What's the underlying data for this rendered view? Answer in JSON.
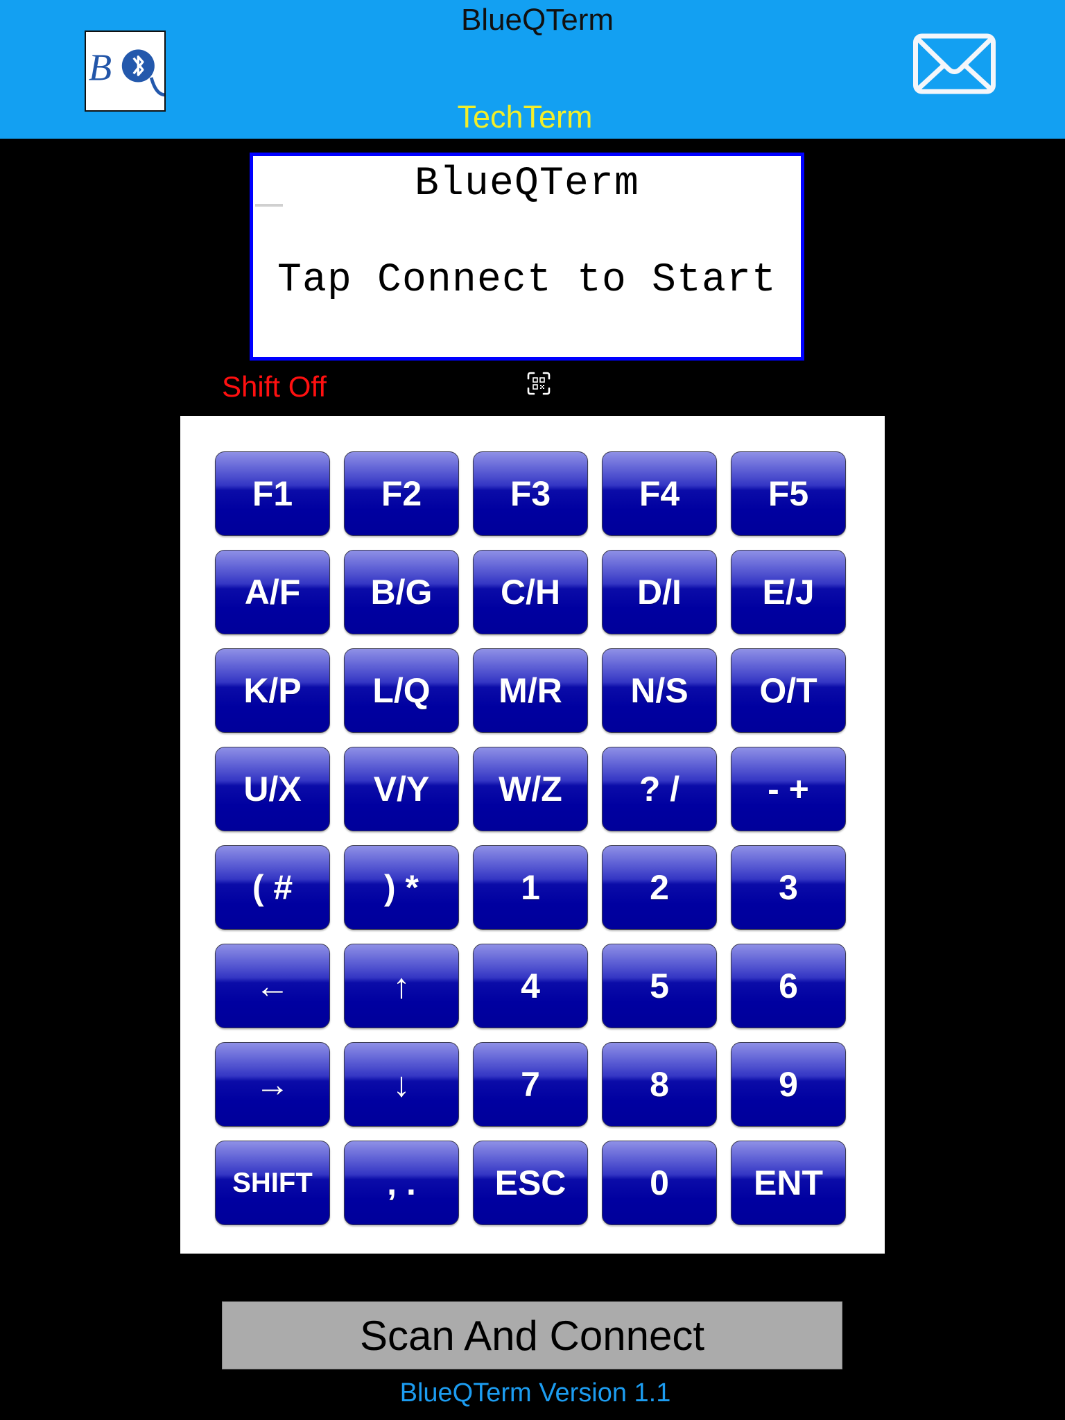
{
  "header": {
    "title": "BlueQTerm",
    "subtitle": "TechTerm",
    "logo_text": "BQ",
    "logo_icon": "bluetooth-icon",
    "mail_icon": "mail-icon"
  },
  "terminal": {
    "lines": [
      "BlueQTerm",
      "Tap Connect to Start"
    ]
  },
  "status": {
    "shift": "Shift Off",
    "qr_icon": "qr-scan-icon"
  },
  "keypad": {
    "rows": [
      [
        "F1",
        "F2",
        "F3",
        "F4",
        "F5"
      ],
      [
        "A/F",
        "B/G",
        "C/H",
        "D/I",
        "E/J"
      ],
      [
        "K/P",
        "L/Q",
        "M/R",
        "N/S",
        "O/T"
      ],
      [
        "U/X",
        "V/Y",
        "W/Z",
        "? /",
        "- +"
      ],
      [
        "( #",
        ") *",
        "1",
        "2",
        "3"
      ],
      [
        "←",
        "↑",
        "4",
        "5",
        "6"
      ],
      [
        "→",
        "↓",
        "7",
        "8",
        "9"
      ],
      [
        "SHIFT",
        ", .",
        "ESC",
        "0",
        "ENT"
      ]
    ]
  },
  "footer": {
    "scan_button": "Scan And Connect",
    "version": "BlueQTerm Version 1.1"
  },
  "colors": {
    "header_bg": "#13a0f2",
    "subtitle": "#f2ee2a",
    "terminal_border": "#0000ff",
    "shift_status": "#ff1010",
    "key": "#0000a0",
    "version": "#1c9cf0"
  }
}
